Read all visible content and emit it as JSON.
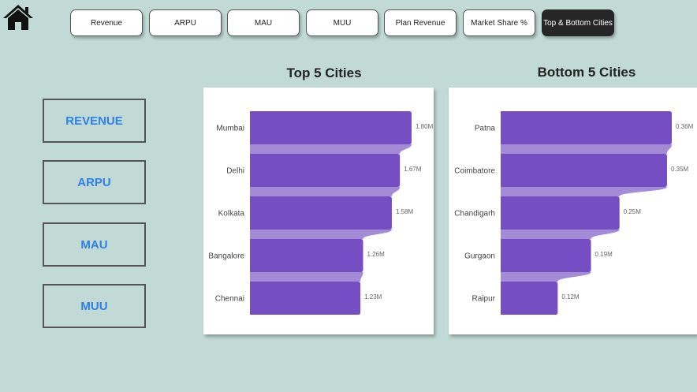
{
  "nav": {
    "tabs": [
      {
        "label": "Revenue"
      },
      {
        "label": "ARPU"
      },
      {
        "label": "MAU"
      },
      {
        "label": "MUU"
      },
      {
        "label": "Plan Revenue"
      },
      {
        "label": "Market Share %"
      },
      {
        "label": "Top & Bottom Cities",
        "active": true
      }
    ]
  },
  "sidebar": {
    "buttons": [
      {
        "label": "REVENUE"
      },
      {
        "label": "ARPU"
      },
      {
        "label": "MAU"
      },
      {
        "label": "MUU"
      }
    ]
  },
  "colors": {
    "background": "#c1dad6",
    "bar": "#744ec2",
    "connector": "#a48bd6",
    "accent_text": "#2e7fe6",
    "active_tab": "#262626"
  },
  "icons": {
    "home": "home-icon"
  },
  "chart_data": [
    {
      "type": "bar",
      "title": "Top 5 Cities",
      "categories": [
        "Mumbai",
        "Delhi",
        "Kolkata",
        "Bangalore",
        "Chennai"
      ],
      "values": [
        1.8,
        1.67,
        1.58,
        1.26,
        1.23
      ],
      "value_labels": [
        "1.80M",
        "1.67M",
        "1.58M",
        "1.26M",
        "1.23M"
      ],
      "unit": "M",
      "xlim": [
        0,
        1.8
      ]
    },
    {
      "type": "bar",
      "title": "Bottom 5 Cities",
      "categories": [
        "Patna",
        "Coimbatore",
        "Chandigarh",
        "Gurgaon",
        "Raipur"
      ],
      "values": [
        0.36,
        0.35,
        0.25,
        0.19,
        0.12
      ],
      "value_labels": [
        "0.36M",
        "0.35M",
        "0.25M",
        "0.19M",
        "0.12M"
      ],
      "unit": "M",
      "xlim": [
        0,
        0.36
      ]
    }
  ]
}
